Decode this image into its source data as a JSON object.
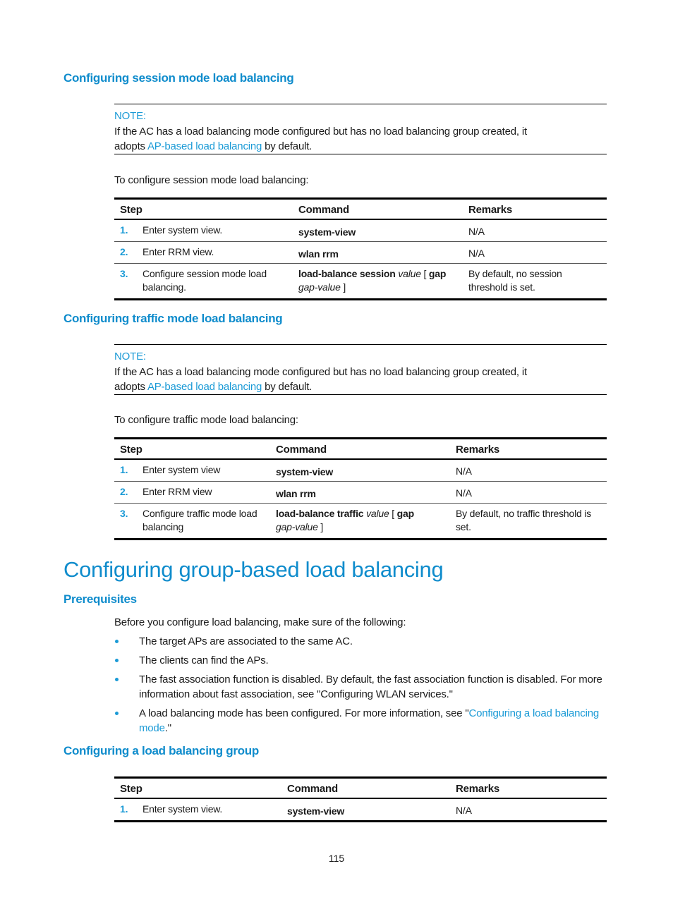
{
  "sections": {
    "session": {
      "heading": "Configuring session mode load balancing",
      "note_label": "NOTE:",
      "note_text_1": "If the AC has a load balancing mode configured but has no load balancing group created, it",
      "note_text_2_pre": "adopts ",
      "note_link": "AP-based load balancing",
      "note_text_2_post": " by default.",
      "intro": "To configure session mode load balancing:",
      "table": {
        "headers": [
          "Step",
          "Command",
          "Remarks"
        ],
        "rows": [
          {
            "num": "1.",
            "step": "Enter system view.",
            "cmd_bold": "system-view",
            "cmd_rest": "",
            "cmd_line2": "",
            "remark": "N/A"
          },
          {
            "num": "2.",
            "step": "Enter RRM view.",
            "cmd_bold": "wlan rrm",
            "cmd_rest": "",
            "cmd_line2": "",
            "remark": "N/A"
          },
          {
            "num": "3.",
            "step": "Configure session mode load balancing.",
            "cmd_bold": "load-balance session",
            "cmd_italic": "value",
            "cmd_mid": " [ ",
            "cmd_bold2": "gap",
            "cmd_line2_italic": "gap-value",
            "cmd_line2_end": " ]",
            "remark": "By default, no session threshold is set."
          }
        ]
      }
    },
    "traffic": {
      "heading": "Configuring traffic mode load balancing",
      "note_label": "NOTE:",
      "note_text_1": "If the AC has a load balancing mode configured but has no load balancing group created, it",
      "note_text_2_pre": "adopts ",
      "note_link": "AP-based load balancing",
      "note_text_2_post": " by default.",
      "intro": "To configure traffic mode load balancing:",
      "table": {
        "headers": [
          "Step",
          "Command",
          "Remarks"
        ],
        "rows": [
          {
            "num": "1.",
            "step": "Enter system view",
            "cmd_bold": "system-view",
            "remark": "N/A"
          },
          {
            "num": "2.",
            "step": "Enter RRM view",
            "cmd_bold": "wlan rrm",
            "remark": "N/A"
          },
          {
            "num": "3.",
            "step": "Configure traffic mode load balancing",
            "cmd_bold": "load-balance traffic",
            "cmd_italic": "value",
            "cmd_mid": " [ ",
            "cmd_bold2": "gap",
            "cmd_line2_italic": "gap-value",
            "cmd_line2_end": " ]",
            "remark": "By default, no traffic threshold is set."
          }
        ]
      }
    },
    "group": {
      "title": "Configuring group-based load balancing",
      "prereq_heading": "Prerequisites",
      "prereq_intro": "Before you configure load balancing, make sure of the following:",
      "prereq_items": [
        {
          "text": "The target APs are associated to the same AC."
        },
        {
          "text": "The clients can find the APs."
        },
        {
          "text": "The fast association function is disabled. By default, the fast association function is disabled. For more information about fast association, see \"Configuring WLAN services.\""
        },
        {
          "text_pre": "A load balancing mode has been configured. For more information, see \"",
          "link": "Configuring a load balancing mode",
          "text_post": ".\""
        }
      ],
      "group_heading": "Configuring a load balancing group",
      "table": {
        "headers": [
          "Step",
          "Command",
          "Remarks"
        ],
        "rows": [
          {
            "num": "1.",
            "step": "Enter system view.",
            "cmd_bold": "system-view",
            "remark": "N/A"
          }
        ]
      }
    }
  },
  "footer": {
    "page_number": "115"
  },
  "colors": {
    "heading": "#0f8ccc",
    "link": "#1a9ad6",
    "rule": "#000000"
  }
}
